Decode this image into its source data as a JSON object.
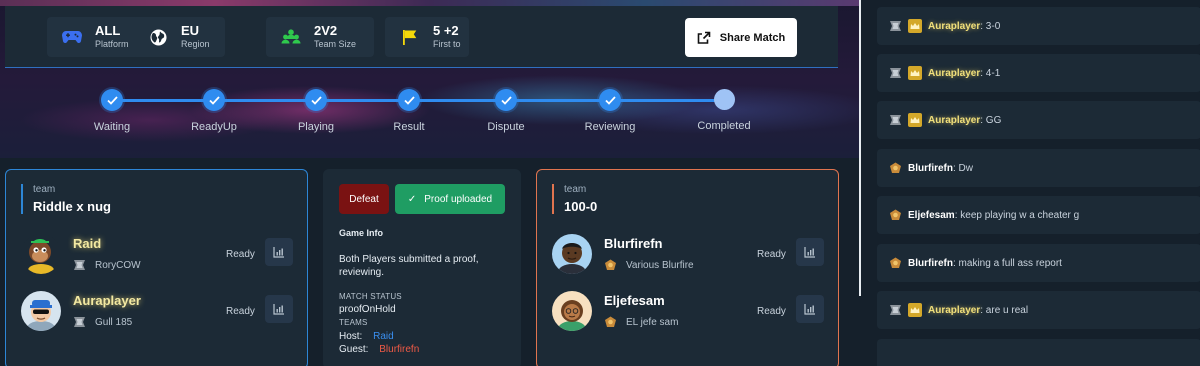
{
  "match_info": {
    "platform": {
      "value": "ALL",
      "label": "Platform",
      "icon": "gamepad-icon"
    },
    "region": {
      "value": "EU",
      "label": "Region",
      "icon": "globe-icon"
    },
    "team_size": {
      "value": "2V2",
      "label": "Team Size",
      "icon": "team-icon"
    },
    "first_to": {
      "value": "5 +2",
      "label": "First to",
      "icon": "flag-icon"
    }
  },
  "share_button": {
    "label": "Share Match",
    "icon": "share-icon"
  },
  "progress_steps": [
    {
      "label": "Waiting",
      "status": "done"
    },
    {
      "label": "ReadyUp",
      "status": "done"
    },
    {
      "label": "Playing",
      "status": "done"
    },
    {
      "label": "Result",
      "status": "done"
    },
    {
      "label": "Dispute",
      "status": "done"
    },
    {
      "label": "Reviewing",
      "status": "done"
    },
    {
      "label": "Completed",
      "status": "pending"
    }
  ],
  "host_team": {
    "caption": "team",
    "name": "Riddle x nug",
    "players": [
      {
        "name": "Raid",
        "sub": "RoryCOW",
        "status": "Ready"
      },
      {
        "name": "Auraplayer",
        "sub": "Gull 185",
        "status": "Ready"
      }
    ]
  },
  "guest_team": {
    "caption": "team",
    "name": "100-0",
    "players": [
      {
        "name": "Blurfirefn",
        "sub": "Various Blurfire",
        "status": "Ready"
      },
      {
        "name": "Eljefesam",
        "sub": "EL jefe sam",
        "status": "Ready"
      }
    ]
  },
  "result": {
    "defeat_label": "Defeat",
    "proof_label": "Proof uploaded",
    "game_info_label": "Game Info",
    "game_info_text": "Both Players submitted a proof, reviewing.",
    "match_status_label": "MATCH STATUS",
    "match_status_value": "proofOnHold",
    "teams_label": "TEAMS",
    "host_label": "Host:",
    "host_value": "Raid",
    "guest_label": "Guest:",
    "guest_value": "Blurfirefn"
  },
  "colors": {
    "accent_blue": "#2f8cf0",
    "guest_orange": "#e0744f",
    "defeat_red": "#7a1212",
    "proof_green": "#1f9d63",
    "panel": "#1c2a36",
    "background": "#15202b"
  },
  "chat": [
    {
      "author": "Auraplayer",
      "message": ": 3-0"
    },
    {
      "author": "Auraplayer",
      "message": ": 4-1"
    },
    {
      "author": "Auraplayer",
      "message": ": GG"
    },
    {
      "author": "Blurfirefn",
      "message": ": Dw"
    },
    {
      "author": "Eljefesam",
      "message": ": keep playing w a cheater g"
    },
    {
      "author": "Blurfirefn",
      "message": ": making a full ass report"
    },
    {
      "author": "Auraplayer",
      "message": ": are u real"
    }
  ]
}
